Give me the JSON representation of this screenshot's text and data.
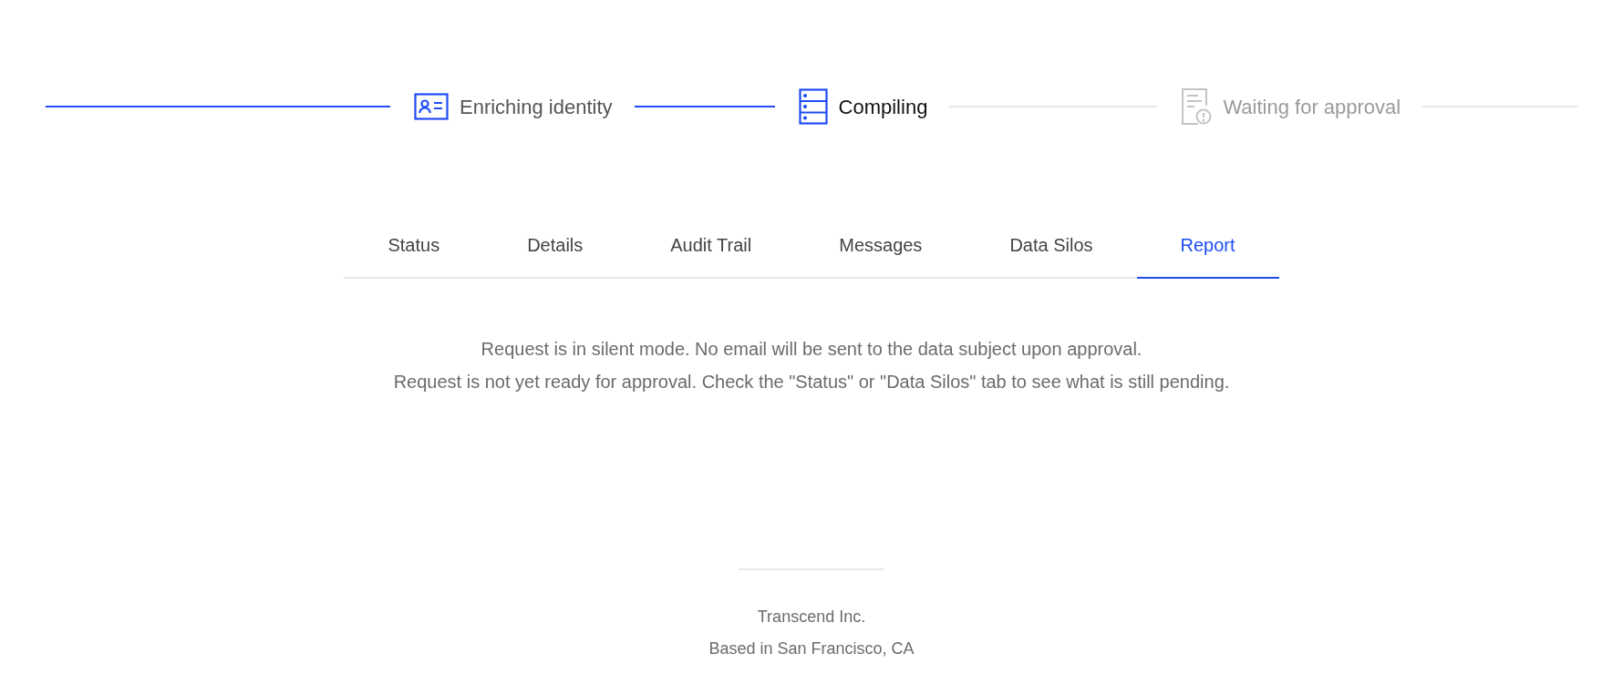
{
  "steps": [
    {
      "label": "Enriching identity",
      "kind": "identity",
      "reached": true,
      "current": false
    },
    {
      "label": "Compiling",
      "kind": "compile",
      "reached": true,
      "current": true
    },
    {
      "label": "Waiting for approval",
      "kind": "approval",
      "reached": false,
      "current": false
    }
  ],
  "tabs": [
    {
      "label": "Status",
      "selected": false
    },
    {
      "label": "Details",
      "selected": false
    },
    {
      "label": "Audit Trail",
      "selected": false
    },
    {
      "label": "Messages",
      "selected": false
    },
    {
      "label": "Data Silos",
      "selected": false
    },
    {
      "label": "Report",
      "selected": true
    }
  ],
  "messages": [
    "Request is in silent mode. No email will be sent to the data subject upon approval.",
    "Request is not yet ready for approval. Check the \"Status\" or \"Data Silos\" tab to see what is still pending."
  ],
  "footer": [
    "Transcend Inc.",
    "Based in San Francisco, CA"
  ]
}
